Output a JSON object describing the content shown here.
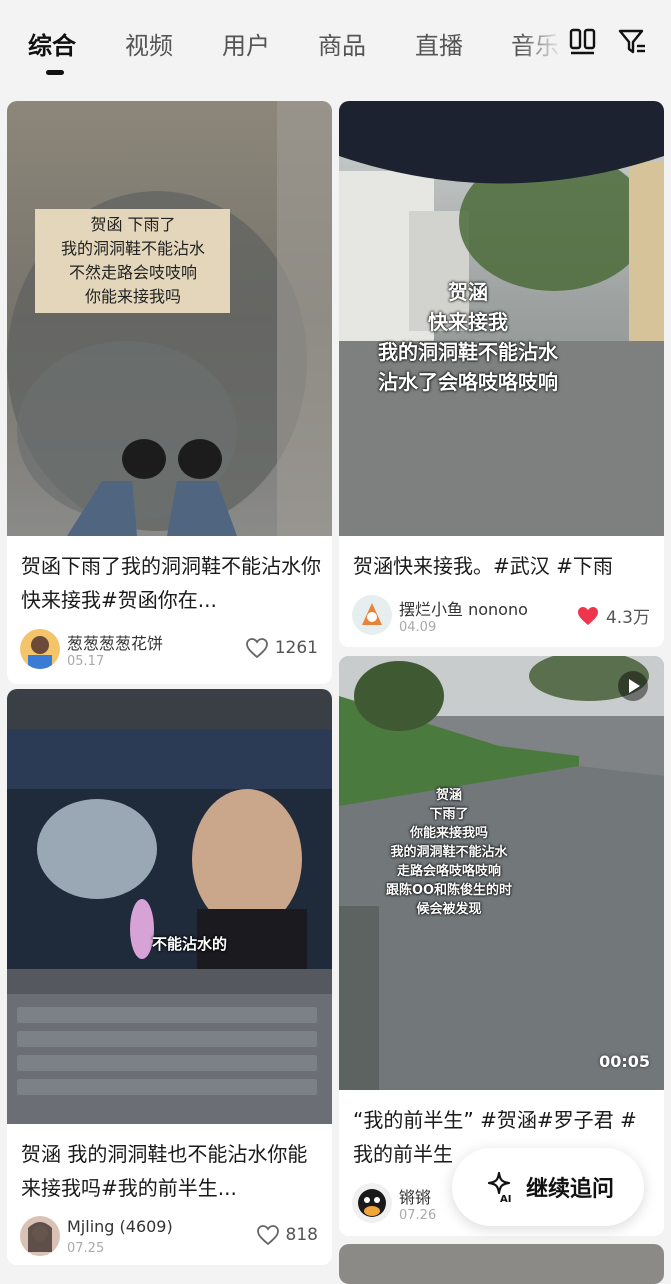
{
  "tabs": [
    {
      "label": "综合",
      "active": true
    },
    {
      "label": "视频",
      "active": false
    },
    {
      "label": "用户",
      "active": false
    },
    {
      "label": "商品",
      "active": false
    },
    {
      "label": "直播",
      "active": false
    },
    {
      "label": "音乐",
      "active": false
    }
  ],
  "toolbar": {
    "layout_icon": "dual-column-icon",
    "filter_icon": "filter-icon"
  },
  "cards": [
    {
      "overlay_lines": [
        "贺函  下雨了",
        "我的洞洞鞋不能沾水",
        "不然走路会吱吱响",
        "你能来接我吗"
      ],
      "title": "贺函下雨了我的洞洞鞋不能沾水你快来接我#贺函你在...",
      "author": "葱葱葱葱花饼",
      "date": "05.17",
      "likes": "1261",
      "liked": false
    },
    {
      "overlay_lines": [
        "贺涵",
        "快来接我",
        "我的洞洞鞋不能沾水",
        "沾水了会咯吱咯吱响"
      ],
      "title": "贺涵快来接我。#武汉 #下雨",
      "author": "摆烂小鱼 nonono",
      "date": "04.09",
      "likes": "4.3万",
      "liked": true
    },
    {
      "subtitle": "不能沾水的",
      "title": "贺涵 我的洞洞鞋也不能沾水你能来接我吗#我的前半生...",
      "author": "Mjling (4609)",
      "date": "07.25",
      "likes": "818",
      "liked": false
    },
    {
      "overlay_lines": [
        "贺涵",
        "下雨了",
        "你能来接我吗",
        "我的洞洞鞋不能沾水",
        "走路会咯吱咯吱响",
        "跟陈OO和陈俊生的时",
        "候会被发现"
      ],
      "duration": "00:05",
      "title": "“我的前半生” #贺涵#罗子君 #我的前半生",
      "author": "锵锵",
      "date": "07.26",
      "likes": "",
      "liked": false
    }
  ],
  "float_button": {
    "label": "继续追问",
    "icon": "ai-sparkle-icon"
  },
  "colors": {
    "accent_like": "#f0344c",
    "text_main": "#1a1a1a",
    "bg": "#f3f3f3"
  }
}
